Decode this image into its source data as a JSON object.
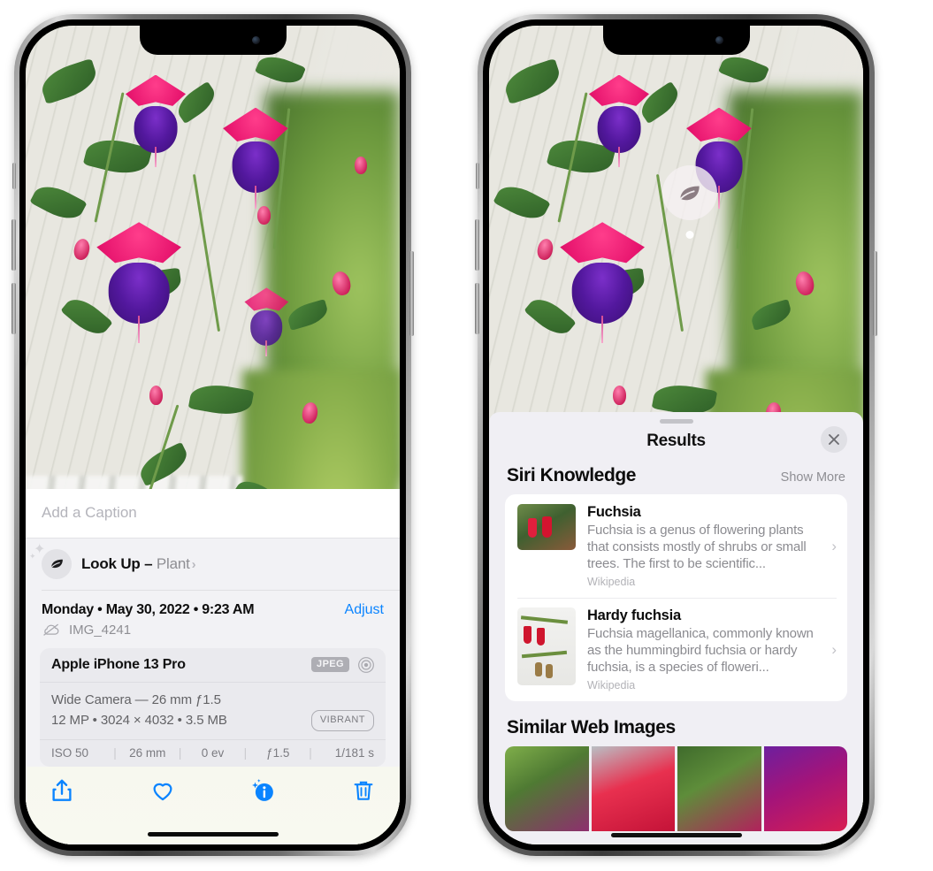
{
  "left_phone": {
    "caption_placeholder": "Add a Caption",
    "lookup": {
      "label": "Look Up – ",
      "subject": "Plant",
      "chevron": "›",
      "icon": "leaf-icon"
    },
    "date": "Monday • May 30, 2022 • 9:23 AM",
    "adjust_label": "Adjust",
    "filename": "IMG_4241",
    "exif": {
      "device": "Apple iPhone 13 Pro",
      "format_badge": "JPEG",
      "lens_line": "Wide Camera — 26 mm ƒ1.5",
      "specs_line": "12 MP • 3024 × 4032 • 3.5 MB",
      "style_badge": "VIBRANT",
      "settings": [
        "ISO 50",
        "26 mm",
        "0 ev",
        "ƒ1.5",
        "1/181 s"
      ],
      "separator": "|"
    },
    "toolbar": {
      "share_label": "share-icon",
      "favorite_label": "heart-icon",
      "info_label": "info-icon",
      "delete_label": "trash-icon"
    }
  },
  "right_phone": {
    "visual_lookup_badge": "leaf-icon",
    "sheet": {
      "title": "Results",
      "close_label": "×"
    },
    "siri_knowledge": {
      "section_title": "Siri Knowledge",
      "action_label": "Show More",
      "results": [
        {
          "title": "Fuchsia",
          "description": "Fuchsia is a genus of flowering plants that consists mostly of shrubs or small trees. The first to be scientific...",
          "source": "Wikipedia",
          "chevron": "›"
        },
        {
          "title": "Hardy fuchsia",
          "description": "Fuchsia magellanica, commonly known as the hummingbird fuchsia or hardy fuchsia, is a species of floweri...",
          "source": "Wikipedia",
          "chevron": "›"
        }
      ]
    },
    "similar_web_images": {
      "section_title": "Similar Web Images",
      "thumbnails": [
        "web-image-1",
        "web-image-2",
        "web-image-3",
        "web-image-4"
      ]
    }
  },
  "colors": {
    "accent_blue": "#0a84ff",
    "sheet_bg": "#f2f2f5",
    "results_bg": "#f0eff4",
    "card_bg": "#ffffff",
    "muted_text": "#8e8e93"
  }
}
